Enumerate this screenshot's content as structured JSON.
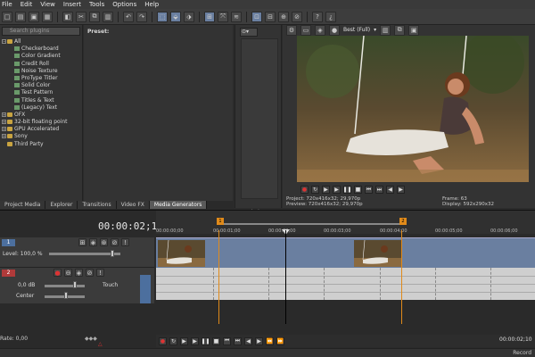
{
  "menu": [
    "File",
    "Edit",
    "View",
    "Insert",
    "Tools",
    "Options",
    "Help"
  ],
  "explorer": {
    "search_placeholder": "Search plugins",
    "tree": [
      {
        "label": "All",
        "kind": "folder",
        "depth": 0
      },
      {
        "label": "Checkerboard",
        "kind": "gen",
        "depth": 2
      },
      {
        "label": "Color Gradient",
        "kind": "gen",
        "depth": 2
      },
      {
        "label": "Credit Roll",
        "kind": "gen",
        "depth": 2
      },
      {
        "label": "Noise Texture",
        "kind": "gen",
        "depth": 2
      },
      {
        "label": "ProType Titler",
        "kind": "gen",
        "depth": 2
      },
      {
        "label": "Solid Color",
        "kind": "gen",
        "depth": 2
      },
      {
        "label": "Test Pattern",
        "kind": "gen",
        "depth": 2
      },
      {
        "label": "Titles & Text",
        "kind": "gen",
        "depth": 2
      },
      {
        "label": "(Legacy) Text",
        "kind": "gen",
        "depth": 2
      },
      {
        "label": "OFX",
        "kind": "folder",
        "depth": 0
      },
      {
        "label": "32-bit floating point",
        "kind": "folder",
        "depth": 0
      },
      {
        "label": "GPU Accelerated",
        "kind": "folder",
        "depth": 0
      },
      {
        "label": "Sony",
        "kind": "folder",
        "depth": 0
      },
      {
        "label": "Third Party",
        "kind": "folder",
        "depth": 0
      }
    ]
  },
  "preset_label": "Preset:",
  "tabs": [
    "Project Media",
    "Explorer",
    "Transitions",
    "Video FX",
    "Media Generators"
  ],
  "preview": {
    "quality": "Best (Full)",
    "project_label": "Project:",
    "project_value": "720x416x32; 29,970p",
    "preview_label": "Preview:",
    "preview_value": "720x416x32; 29,970p",
    "frame_label": "Frame:",
    "frame_value": "63",
    "display_label": "Display:",
    "display_value": "592x290x32"
  },
  "timeline": {
    "timecode": "00:00:02;10",
    "ruler": [
      "00:00:00;00",
      "00:00:01;00",
      "00:00:02;00",
      "00:00:03;00",
      "00:00:04;00",
      "00:00:05;00",
      "00:00:06;00"
    ],
    "markers": [
      "1",
      "2"
    ],
    "track1": {
      "num": "1",
      "level": "Level: 100,0 %"
    },
    "track2": {
      "num": "2",
      "vol": "0,0 dB",
      "pan_mode": "Touch",
      "pan": "Center"
    },
    "rate": "Rate: 0,00",
    "bottom_timecode": "00:00:02;10",
    "record_time": "Record"
  },
  "colors": {
    "video_track": "#6a7fa0",
    "marker": "#e08a1a",
    "audio_track": "#cfcfcf"
  }
}
